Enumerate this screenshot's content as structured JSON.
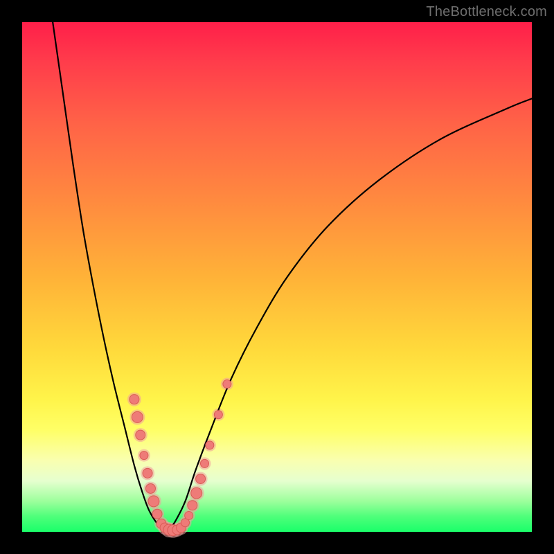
{
  "watermark": "TheBottleneck.com",
  "colors": {
    "dot_fill": "#ee7b78",
    "dot_stroke": "#da5a55",
    "curve": "#000000",
    "frame_bg": "#000000"
  },
  "chart_data": {
    "type": "line",
    "title": "",
    "xlabel": "",
    "ylabel": "",
    "xlim": [
      0,
      100
    ],
    "ylim": [
      0,
      100
    ],
    "grid": false,
    "legend": false,
    "series": [
      {
        "name": "left-curve",
        "x": [
          6,
          8,
          10,
          12,
          14,
          16,
          18,
          20,
          22,
          23.5,
          25,
          27,
          28.5
        ],
        "y": [
          100,
          86,
          72,
          59,
          48,
          38,
          29,
          21,
          13,
          8,
          4,
          1,
          0
        ]
      },
      {
        "name": "right-curve",
        "x": [
          28.5,
          30,
          32,
          34,
          37,
          41,
          46,
          52,
          60,
          70,
          82,
          95,
          100
        ],
        "y": [
          0,
          2,
          6,
          12,
          20,
          30,
          40,
          50,
          60,
          69,
          77,
          83,
          85
        ]
      }
    ],
    "scatter_points": {
      "name": "highlight-dots",
      "points": [
        {
          "x": 22.0,
          "y": 26.0,
          "r": 7
        },
        {
          "x": 22.6,
          "y": 22.5,
          "r": 8
        },
        {
          "x": 23.2,
          "y": 19.0,
          "r": 7
        },
        {
          "x": 23.9,
          "y": 15.0,
          "r": 6
        },
        {
          "x": 24.6,
          "y": 11.5,
          "r": 7
        },
        {
          "x": 25.2,
          "y": 8.5,
          "r": 7
        },
        {
          "x": 25.8,
          "y": 6.0,
          "r": 8
        },
        {
          "x": 26.5,
          "y": 3.5,
          "r": 7
        },
        {
          "x": 27.3,
          "y": 1.6,
          "r": 7
        },
        {
          "x": 28.0,
          "y": 0.8,
          "r": 7
        },
        {
          "x": 28.8,
          "y": 0.4,
          "r": 8
        },
        {
          "x": 29.6,
          "y": 0.3,
          "r": 8
        },
        {
          "x": 30.4,
          "y": 0.4,
          "r": 7
        },
        {
          "x": 31.2,
          "y": 0.8,
          "r": 7
        },
        {
          "x": 32.0,
          "y": 1.8,
          "r": 6
        },
        {
          "x": 32.7,
          "y": 3.2,
          "r": 6
        },
        {
          "x": 33.4,
          "y": 5.2,
          "r": 7
        },
        {
          "x": 34.2,
          "y": 7.6,
          "r": 8
        },
        {
          "x": 35.0,
          "y": 10.4,
          "r": 7
        },
        {
          "x": 35.8,
          "y": 13.4,
          "r": 6
        },
        {
          "x": 36.8,
          "y": 17.0,
          "r": 6
        },
        {
          "x": 38.5,
          "y": 23.0,
          "r": 6
        },
        {
          "x": 40.2,
          "y": 29.0,
          "r": 6
        }
      ]
    }
  }
}
